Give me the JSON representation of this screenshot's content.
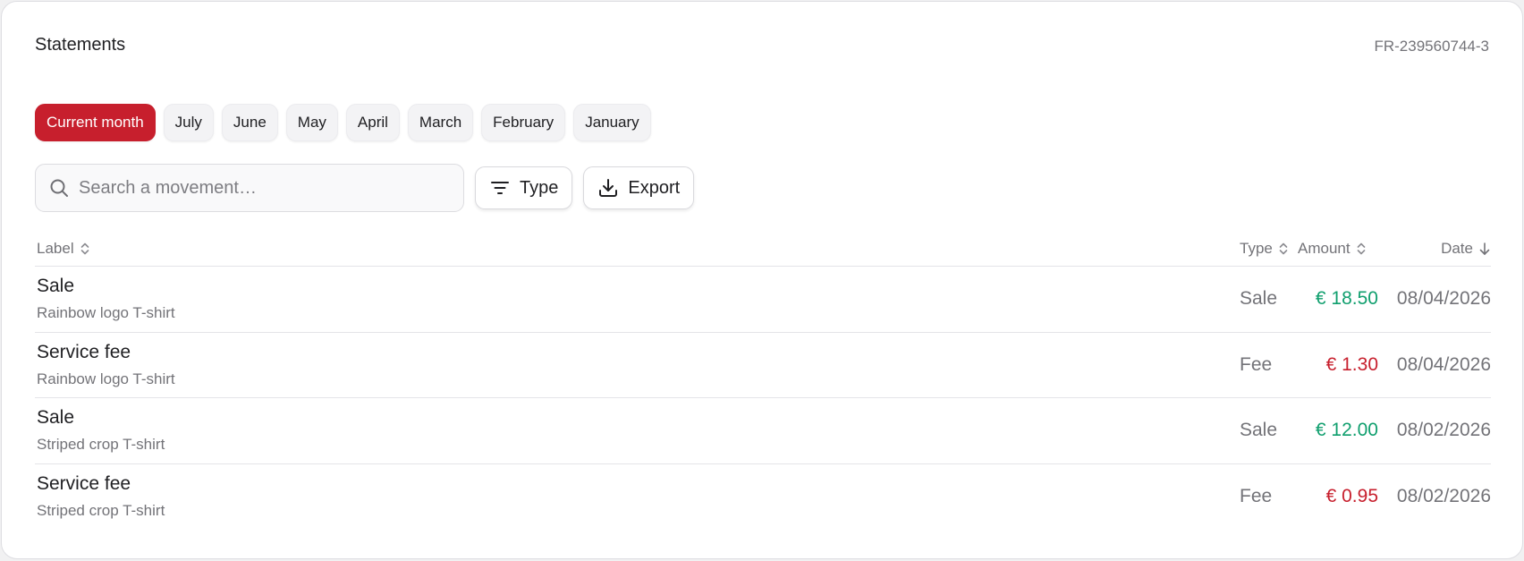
{
  "header": {
    "title": "Statements",
    "reference": "FR-239560744-3"
  },
  "months": [
    {
      "label": "Current month",
      "active": true
    },
    {
      "label": "July",
      "active": false
    },
    {
      "label": "June",
      "active": false
    },
    {
      "label": "May",
      "active": false
    },
    {
      "label": "April",
      "active": false
    },
    {
      "label": "March",
      "active": false
    },
    {
      "label": "February",
      "active": false
    },
    {
      "label": "January",
      "active": false
    }
  ],
  "search": {
    "placeholder": "Search a movement…",
    "value": "",
    "icon": "search-icon"
  },
  "toolbar": {
    "type_label": "Type",
    "type_icon": "filter-icon",
    "export_label": "Export",
    "export_icon": "download-icon"
  },
  "table": {
    "columns": {
      "label": "Label",
      "type": "Type",
      "amount": "Amount",
      "date": "Date"
    },
    "rows": [
      {
        "title": "Sale",
        "subtitle": "Rainbow logo T-shirt",
        "type": "Sale",
        "amount": "€ 18.50",
        "sign": "positive",
        "date": "08/04/2026"
      },
      {
        "title": "Service fee",
        "subtitle": "Rainbow logo T-shirt",
        "type": "Fee",
        "amount": "€ 1.30",
        "sign": "negative",
        "date": "08/04/2026"
      },
      {
        "title": "Sale",
        "subtitle": "Striped crop T-shirt",
        "type": "Sale",
        "amount": "€ 12.00",
        "sign": "positive",
        "date": "08/02/2026"
      },
      {
        "title": "Service fee",
        "subtitle": "Striped crop T-shirt",
        "type": "Fee",
        "amount": "€ 0.95",
        "sign": "negative",
        "date": "08/02/2026"
      }
    ]
  },
  "colors": {
    "accent": "#c71f2d",
    "positive": "#109f6e",
    "negative": "#c71f2d",
    "muted_text": "#737378"
  }
}
